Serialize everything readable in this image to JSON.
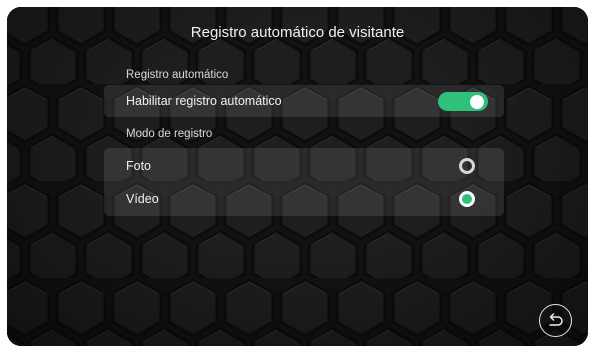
{
  "title": "Registro automático de visitante",
  "auto_register": {
    "section_label": "Registro automático",
    "enable_label": "Habilitar registro automático",
    "enabled": true
  },
  "mode": {
    "section_label": "Modo de registro",
    "options": [
      {
        "label": "Foto",
        "selected": false
      },
      {
        "label": "Vídeo",
        "selected": true
      }
    ]
  },
  "icons": {
    "back": "back-arrow-icon"
  },
  "colors": {
    "accent": "#2fc07a",
    "background": "#161616"
  }
}
